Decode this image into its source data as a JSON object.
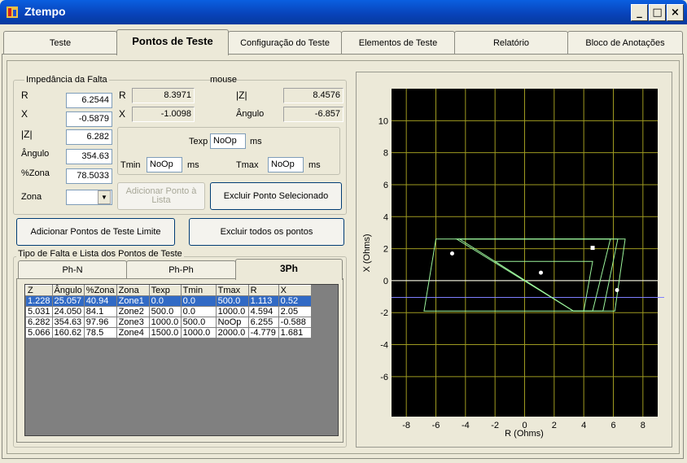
{
  "window": {
    "title": "Ztempo",
    "minimize_label": "_",
    "maximize_label": "□",
    "close_label": "×"
  },
  "tabs": [
    {
      "label": "Teste"
    },
    {
      "label": "Pontos de Teste"
    },
    {
      "label": "Configuração do Teste"
    },
    {
      "label": "Elementos de Teste"
    },
    {
      "label": "Relatório"
    },
    {
      "label": "Bloco de Anotações"
    }
  ],
  "fault": {
    "group_title": "Impedância da Falta",
    "r_label": "R",
    "r_value": "6.2544",
    "x_label": "X",
    "x_value": "-0.5879",
    "z_label": "|Z|",
    "z_value": "6.282",
    "angle_label": "Ângulo",
    "angle_value": "354.63",
    "zone_pct_label": "%Zona",
    "zone_pct_value": "78.5033",
    "zone_label": "Zona",
    "zone_value": ""
  },
  "mouse": {
    "title": "mouse",
    "r_label": "R",
    "r_value": "8.3971",
    "x_label": "X",
    "x_value": "-1.0098",
    "z_label": "|Z|",
    "z_value": "8.4576",
    "angle_label": "Ângulo",
    "angle_value": "-6.857"
  },
  "times": {
    "texp_label": "Texp",
    "texp_value": "NoOp",
    "texp_unit": "ms",
    "tmin_label": "Tmin",
    "tmin_value": "NoOp",
    "tmin_unit": "ms",
    "tmax_label": "Tmax",
    "tmax_value": "NoOp",
    "tmax_unit": "ms"
  },
  "buttons": {
    "add_point": "Adicionar Ponto à Lista",
    "delete_selected": "Excluir Ponto Selecionado",
    "add_limit_points": "Adicionar Pontos de Teste Limite",
    "delete_all": "Excluir todos os pontos"
  },
  "list_group": {
    "title": "Tipo de Falta e Lista dos Pontos de Teste",
    "subtabs": [
      {
        "label": "Ph-N"
      },
      {
        "label": "Ph-Ph"
      },
      {
        "label": "3Ph"
      }
    ]
  },
  "table": {
    "columns": [
      "Z",
      "Ângulo",
      "%Zona",
      "Zona",
      "Texp",
      "Tmin",
      "Tmax",
      "R",
      "X"
    ],
    "rows": [
      [
        "1.228",
        "25.057",
        "40.94",
        "Zone1",
        "0.0",
        "0.0",
        "500.0",
        "1.113",
        "0.52"
      ],
      [
        "5.031",
        "24.050",
        "84.1",
        "Zone2",
        "500.0",
        "0.0",
        "1000.0",
        "4.594",
        "2.05"
      ],
      [
        "6.282",
        "354.63",
        "97.96",
        "Zone3",
        "1000.0",
        "500.0",
        "NoOp",
        "6.255",
        "-0.588"
      ],
      [
        "5.066",
        "160.62",
        "78.5",
        "Zone4",
        "1500.0",
        "1000.0",
        "2000.0",
        "-4.779",
        "1.681"
      ]
    ],
    "selected_row": 0
  },
  "chart_data": {
    "type": "scatter",
    "xlabel": "R (Ohms)",
    "ylabel": "X (Ohms)",
    "xlim": [
      -9,
      9
    ],
    "ylim": [
      -8.5,
      12
    ],
    "xticks": [
      -8,
      -6,
      -4,
      -2,
      0,
      2,
      4,
      6,
      8
    ],
    "yticks": [
      -6,
      -4,
      -2,
      0,
      2,
      4,
      6,
      8,
      10
    ],
    "grid": true,
    "zones": [
      [
        [
          -6.8,
          -1.9
        ],
        [
          -6.0,
          2.6
        ],
        [
          6.8,
          2.6
        ],
        [
          6.1,
          -1.9
        ]
      ],
      [
        [
          -4.6,
          2.6
        ],
        [
          6.3,
          2.6
        ],
        [
          5.3,
          -1.9
        ],
        [
          3.3,
          -1.9
        ]
      ],
      [
        [
          -4.4,
          2.6
        ],
        [
          5.8,
          2.6
        ],
        [
          4.6,
          -1.9
        ],
        [
          3.3,
          -1.9
        ]
      ],
      [
        [
          -2.0,
          1.2
        ],
        [
          4.6,
          1.2
        ],
        [
          4.0,
          -1.9
        ],
        [
          3.3,
          -1.9
        ]
      ]
    ],
    "reference_line": {
      "y": -1.05
    },
    "axis_line": {
      "y": 0
    },
    "points": [
      {
        "x": -4.9,
        "y": 1.7,
        "shape": "circle"
      },
      {
        "x": 1.1,
        "y": 0.5,
        "shape": "circle"
      },
      {
        "x": 4.6,
        "y": 2.05,
        "shape": "square"
      },
      {
        "x": 6.25,
        "y": -0.59,
        "shape": "circle"
      }
    ],
    "colors": {
      "background": "#000000",
      "grid": "#9e9a20",
      "zones": "#9cf59c",
      "reference": "#7f7fff",
      "points": "#ffffff"
    }
  }
}
